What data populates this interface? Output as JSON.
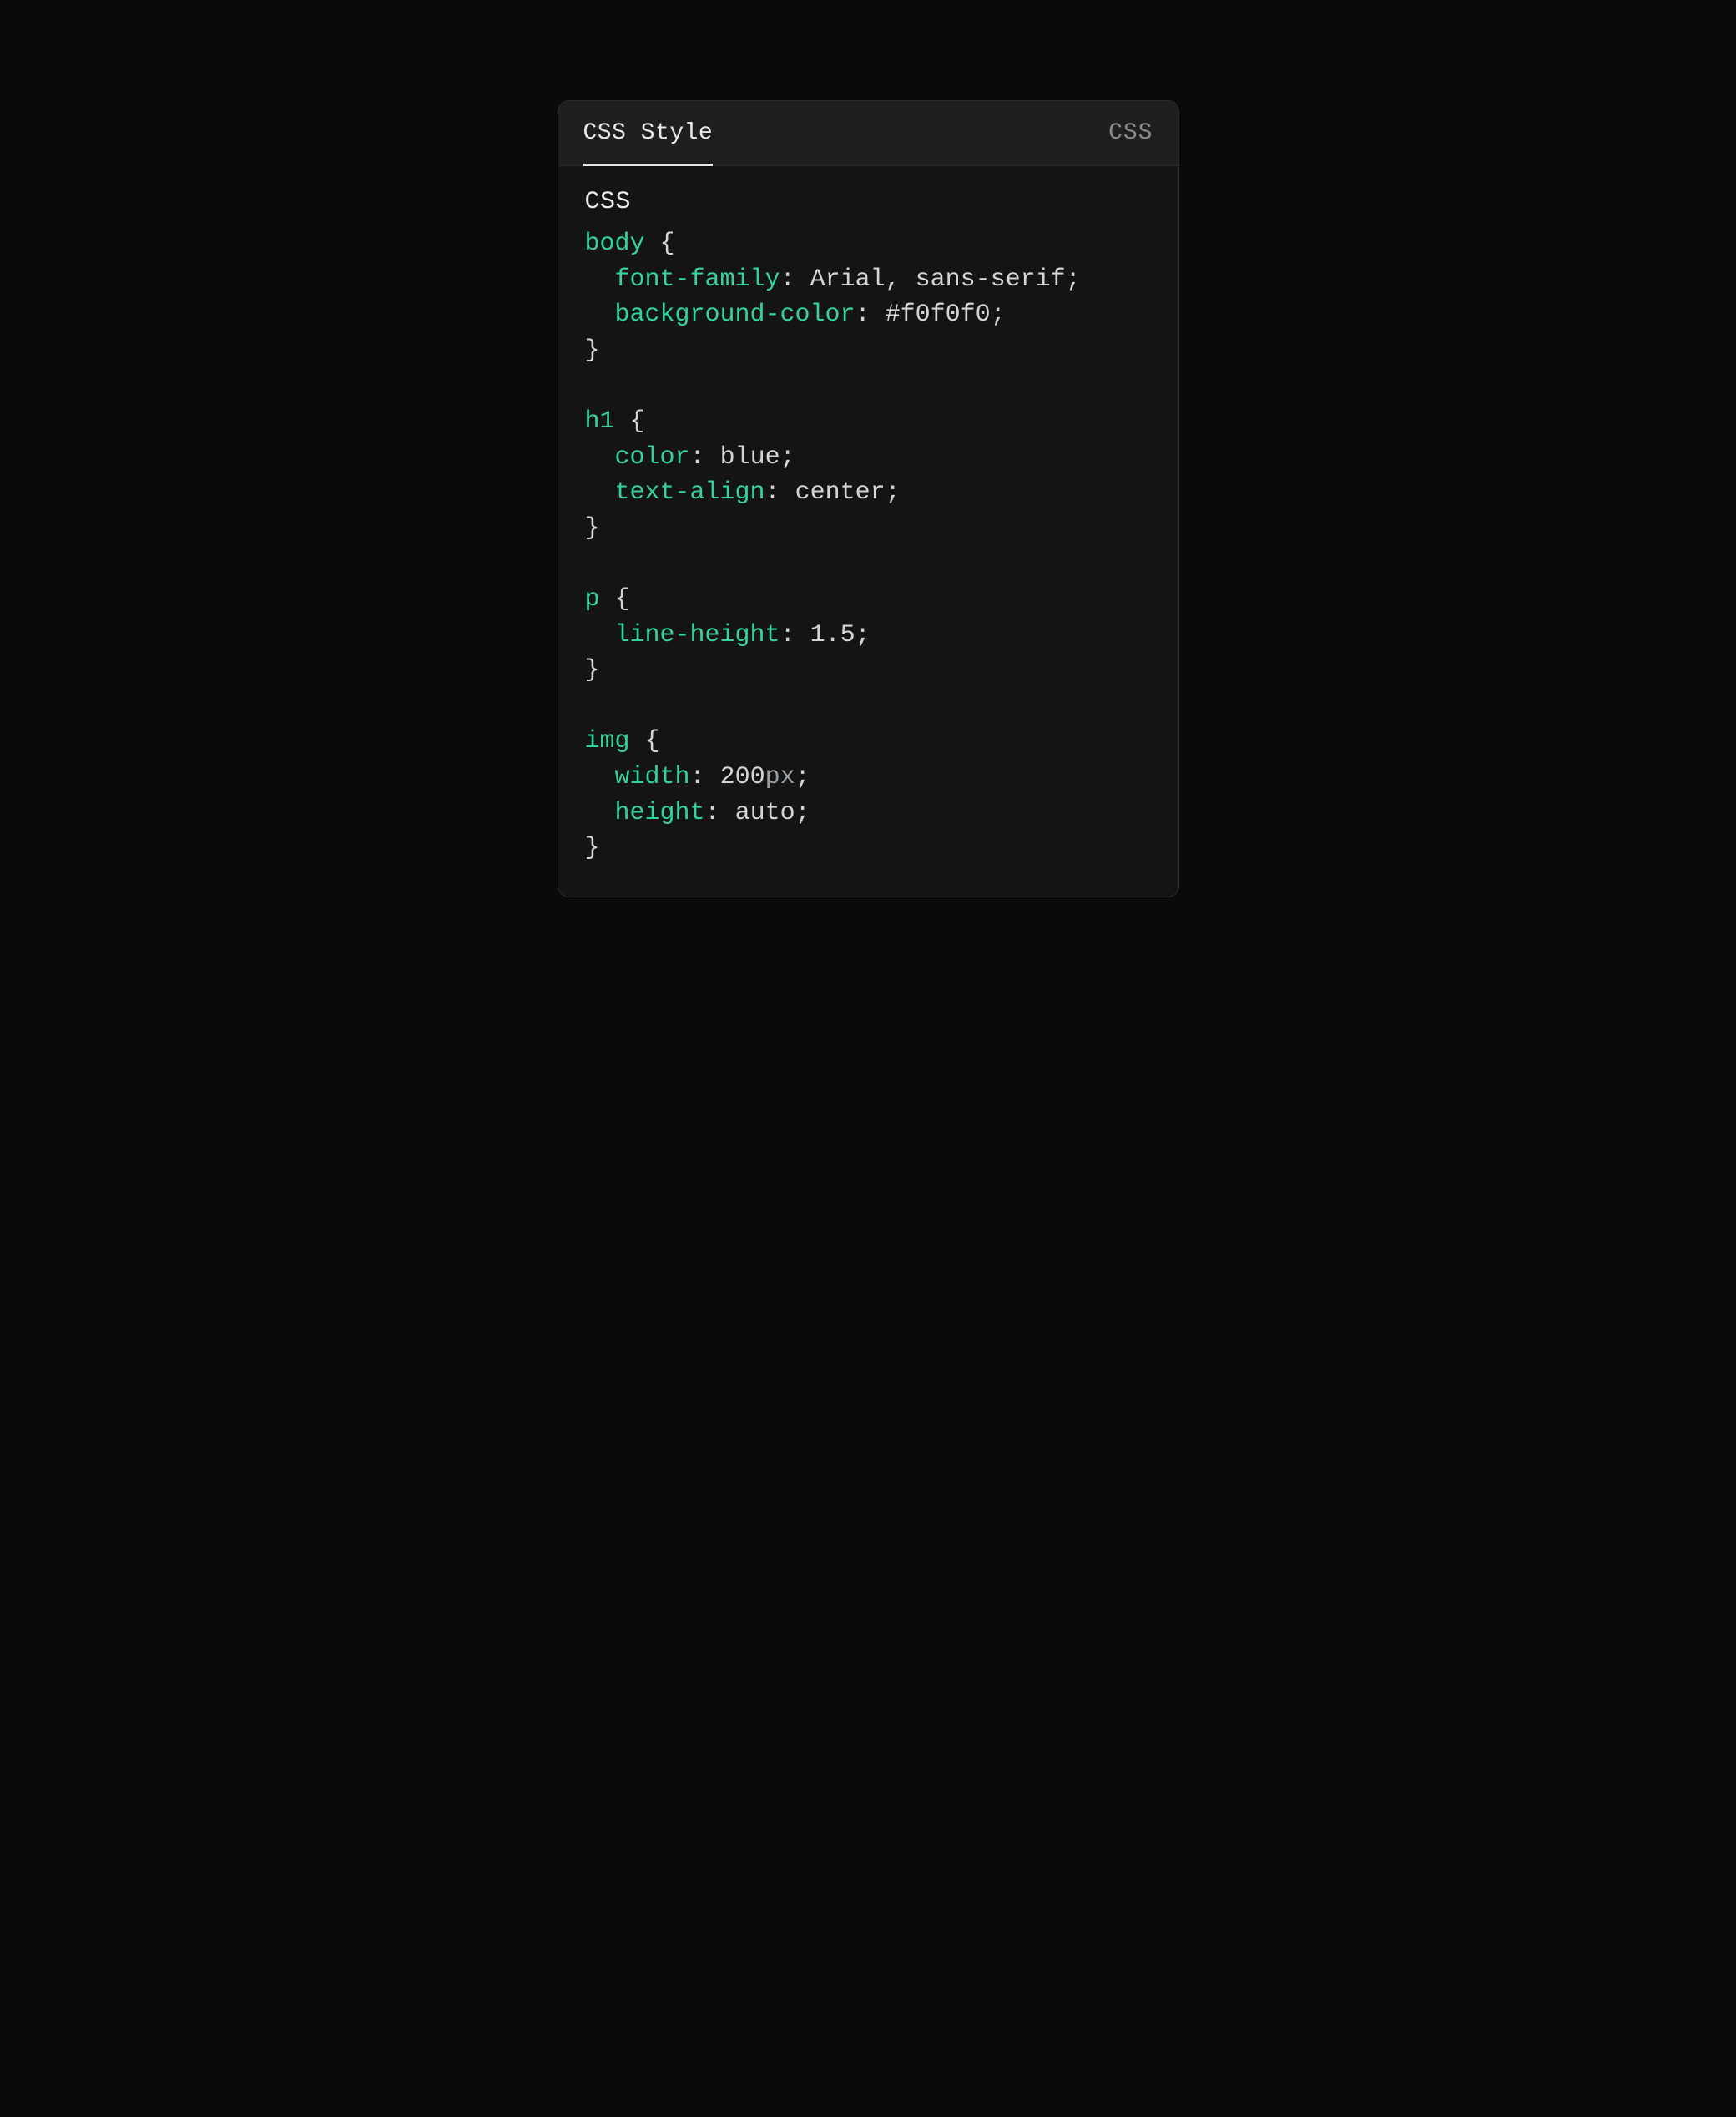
{
  "header": {
    "tab_label": "CSS Style",
    "lang_badge": "CSS"
  },
  "body": {
    "title": "CSS",
    "code_tokens": [
      [
        {
          "t": "body",
          "c": "tok-sel"
        },
        {
          "t": " ",
          "c": "tok-punc"
        },
        {
          "t": "{",
          "c": "tok-punc"
        }
      ],
      [
        {
          "t": "  ",
          "c": "tok-punc"
        },
        {
          "t": "font-family",
          "c": "tok-prop"
        },
        {
          "t": ":",
          "c": "tok-punc"
        },
        {
          "t": " ",
          "c": "tok-punc"
        },
        {
          "t": "Arial",
          "c": "tok-val"
        },
        {
          "t": ",",
          "c": "tok-punc"
        },
        {
          "t": " ",
          "c": "tok-punc"
        },
        {
          "t": "sans-serif",
          "c": "tok-val"
        },
        {
          "t": ";",
          "c": "tok-punc"
        }
      ],
      [
        {
          "t": "  ",
          "c": "tok-punc"
        },
        {
          "t": "background-color",
          "c": "tok-prop"
        },
        {
          "t": ":",
          "c": "tok-punc"
        },
        {
          "t": " ",
          "c": "tok-punc"
        },
        {
          "t": "#f0f0f0",
          "c": "tok-num"
        },
        {
          "t": ";",
          "c": "tok-punc"
        }
      ],
      [
        {
          "t": "}",
          "c": "tok-punc"
        }
      ],
      [],
      [
        {
          "t": "h1",
          "c": "tok-sel"
        },
        {
          "t": " ",
          "c": "tok-punc"
        },
        {
          "t": "{",
          "c": "tok-punc"
        }
      ],
      [
        {
          "t": "  ",
          "c": "tok-punc"
        },
        {
          "t": "color",
          "c": "tok-prop"
        },
        {
          "t": ":",
          "c": "tok-punc"
        },
        {
          "t": " ",
          "c": "tok-punc"
        },
        {
          "t": "blue",
          "c": "tok-val"
        },
        {
          "t": ";",
          "c": "tok-punc"
        }
      ],
      [
        {
          "t": "  ",
          "c": "tok-punc"
        },
        {
          "t": "text-align",
          "c": "tok-prop"
        },
        {
          "t": ":",
          "c": "tok-punc"
        },
        {
          "t": " ",
          "c": "tok-punc"
        },
        {
          "t": "center",
          "c": "tok-val"
        },
        {
          "t": ";",
          "c": "tok-punc"
        }
      ],
      [
        {
          "t": "}",
          "c": "tok-punc"
        }
      ],
      [],
      [
        {
          "t": "p",
          "c": "tok-sel"
        },
        {
          "t": " ",
          "c": "tok-punc"
        },
        {
          "t": "{",
          "c": "tok-punc"
        }
      ],
      [
        {
          "t": "  ",
          "c": "tok-punc"
        },
        {
          "t": "line-height",
          "c": "tok-prop"
        },
        {
          "t": ":",
          "c": "tok-punc"
        },
        {
          "t": " ",
          "c": "tok-punc"
        },
        {
          "t": "1.5",
          "c": "tok-num"
        },
        {
          "t": ";",
          "c": "tok-punc"
        }
      ],
      [
        {
          "t": "}",
          "c": "tok-punc"
        }
      ],
      [],
      [
        {
          "t": "img",
          "c": "tok-sel"
        },
        {
          "t": " ",
          "c": "tok-punc"
        },
        {
          "t": "{",
          "c": "tok-punc"
        }
      ],
      [
        {
          "t": "  ",
          "c": "tok-punc"
        },
        {
          "t": "width",
          "c": "tok-prop"
        },
        {
          "t": ":",
          "c": "tok-punc"
        },
        {
          "t": " ",
          "c": "tok-punc"
        },
        {
          "t": "200",
          "c": "tok-num"
        },
        {
          "t": "px",
          "c": "tok-unit"
        },
        {
          "t": ";",
          "c": "tok-punc"
        }
      ],
      [
        {
          "t": "  ",
          "c": "tok-punc"
        },
        {
          "t": "height",
          "c": "tok-prop"
        },
        {
          "t": ":",
          "c": "tok-punc"
        },
        {
          "t": " ",
          "c": "tok-punc"
        },
        {
          "t": "auto",
          "c": "tok-val"
        },
        {
          "t": ";",
          "c": "tok-punc"
        }
      ],
      [
        {
          "t": "}",
          "c": "tok-punc"
        }
      ]
    ]
  }
}
